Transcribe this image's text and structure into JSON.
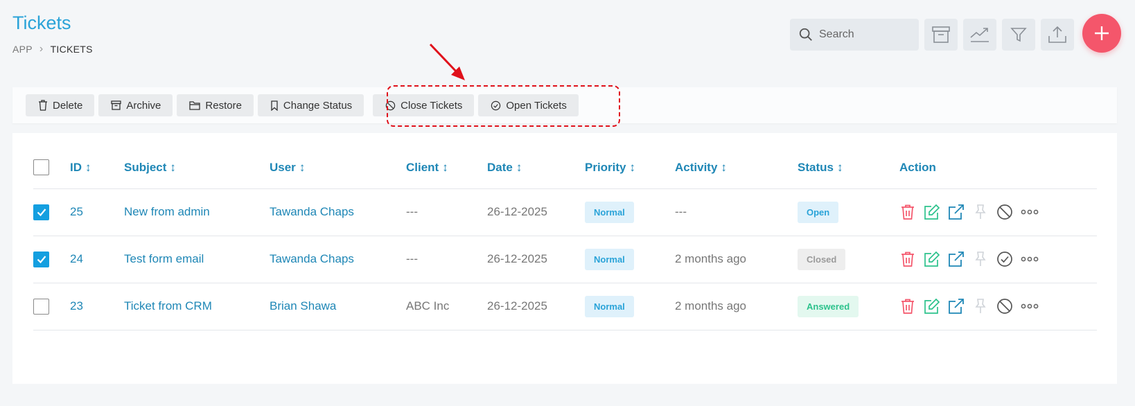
{
  "header": {
    "title": "Tickets",
    "breadcrumb": [
      "APP",
      "TICKETS"
    ]
  },
  "toolbar": {
    "search_placeholder": "Search",
    "icons": [
      "search-icon",
      "archive-icon",
      "chart-icon",
      "filter-icon",
      "export-icon",
      "plus-icon"
    ]
  },
  "bulk_actions": [
    "Delete",
    "Archive",
    "Restore",
    "Change Status",
    "Close Tickets",
    "Open Tickets"
  ],
  "table": {
    "columns": [
      "ID",
      "Subject",
      "User",
      "Client",
      "Date",
      "Priority",
      "Activity",
      "Status",
      "Action"
    ],
    "sort_glyph": "↕",
    "rows": [
      {
        "checked": true,
        "id": "25",
        "subject": "New from admin",
        "user": "Tawanda Chaps",
        "client": "---",
        "date": "26-12-2025",
        "priority": "Normal",
        "activity": "---",
        "status": "Open",
        "toggle_icon": "ban-icon"
      },
      {
        "checked": true,
        "id": "24",
        "subject": "Test form email",
        "user": "Tawanda Chaps",
        "client": "---",
        "date": "26-12-2025",
        "priority": "Normal",
        "activity": "2 months ago",
        "status": "Closed",
        "toggle_icon": "check-circle-icon"
      },
      {
        "checked": false,
        "id": "23",
        "subject": "Ticket from CRM",
        "user": "Brian Shawa",
        "client": "ABC Inc",
        "date": "26-12-2025",
        "priority": "Normal",
        "activity": "2 months ago",
        "status": "Answered",
        "toggle_icon": "ban-icon"
      }
    ]
  },
  "colors": {
    "accent": "#2aa3d8",
    "link": "#1f87b6",
    "add_button": "#f4566b",
    "annotation": "#e0111b",
    "status_open_bg": "#dff1fb",
    "status_open_text": "#2aa3d8",
    "status_closed_bg": "#eeeeee",
    "status_closed_text": "#9a9a9a",
    "status_answered_bg": "#e3f8ef",
    "status_answered_text": "#2cc28c"
  }
}
